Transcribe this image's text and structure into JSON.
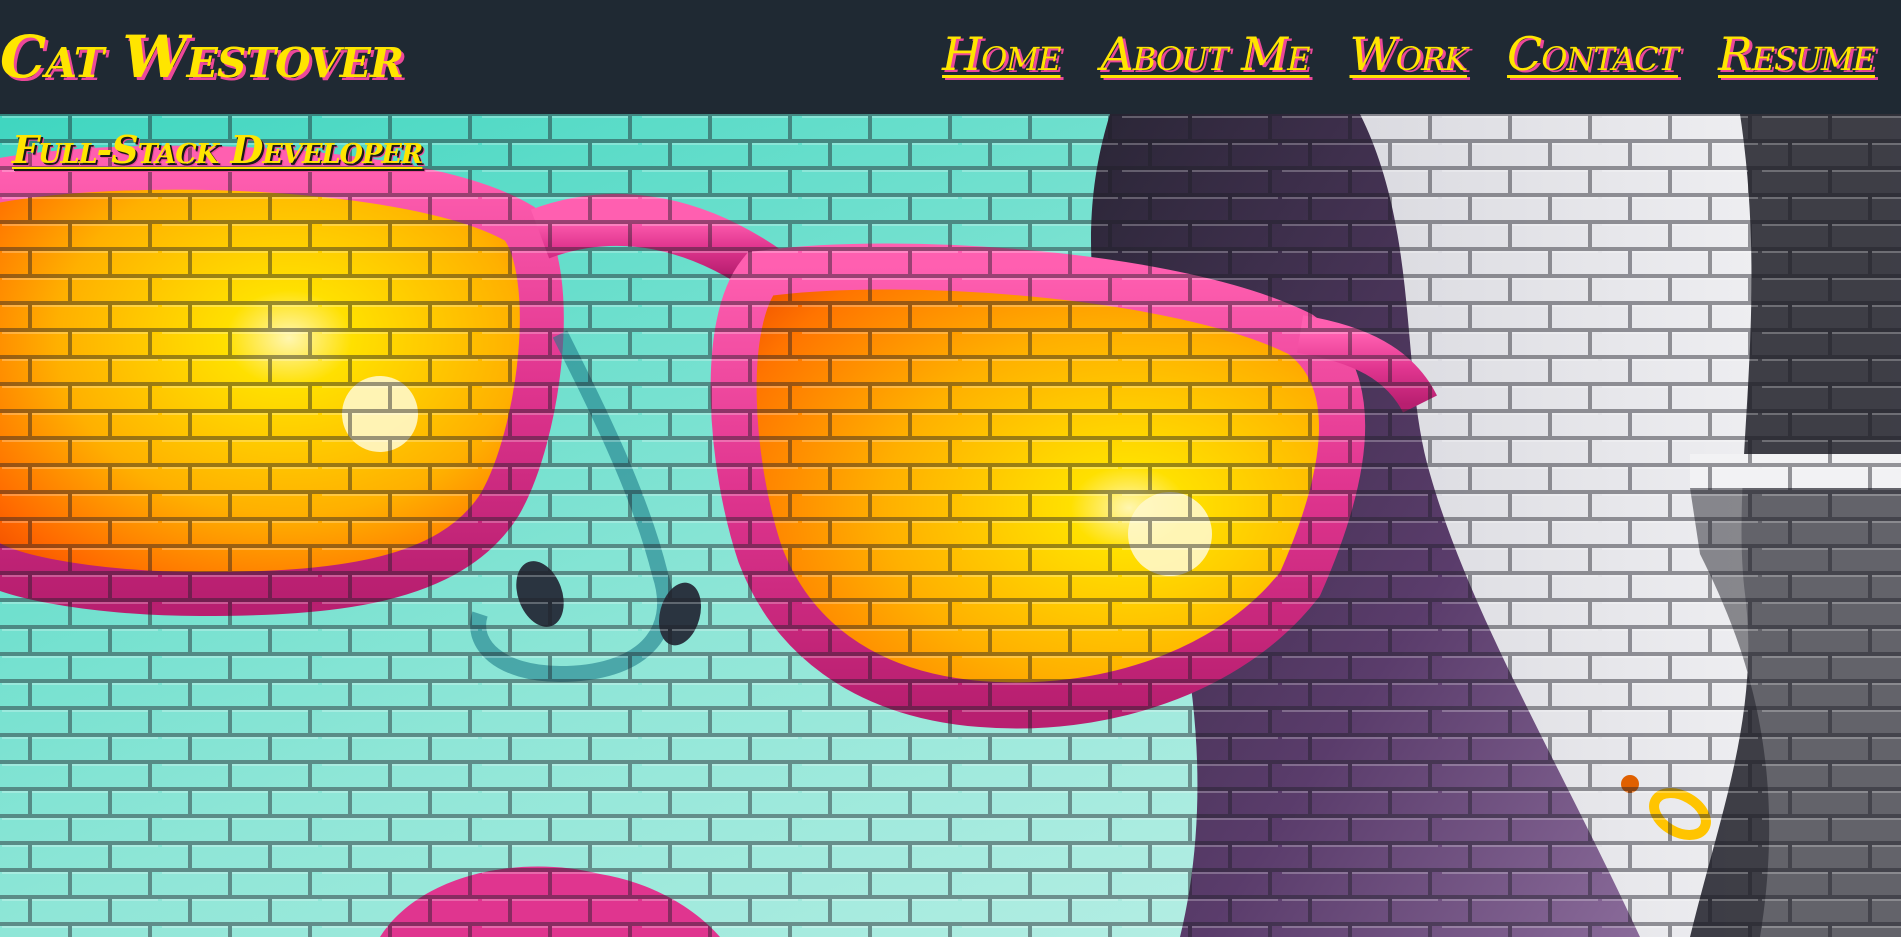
{
  "header": {
    "brand": "Cat Westover",
    "nav": [
      {
        "label": "Home"
      },
      {
        "label": "About Me"
      },
      {
        "label": "Work"
      },
      {
        "label": "Contact"
      },
      {
        "label": "Resume"
      }
    ]
  },
  "hero": {
    "subtitle": "Full-Stack Developer",
    "image": "graffiti-mural-pink-sunglasses"
  },
  "colors": {
    "header_bg": "#1f2933",
    "text_yellow": "#ffe500",
    "text_shadow_pink": "#ec4899",
    "mural_teal": "#3ed1bd",
    "mural_pink": "#e0368f",
    "mural_orange": "#ff8a00",
    "mural_white_brick": "#eeeeee"
  }
}
